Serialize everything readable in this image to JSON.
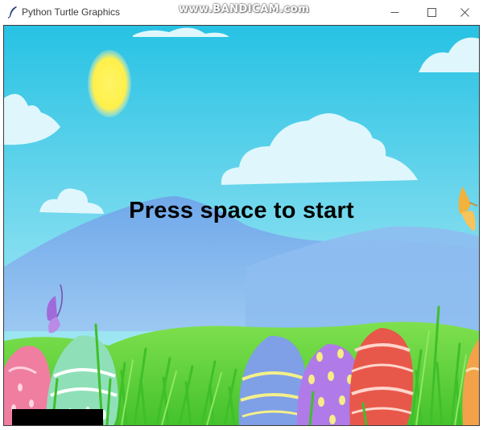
{
  "window": {
    "title": "Python Turtle Graphics",
    "watermark": "www.BANDICAM.com",
    "controls": [
      "minimize",
      "maximize",
      "close"
    ]
  },
  "game": {
    "message": "Press space to start",
    "background": {
      "sky_top": "#2fc6e6",
      "sky_bottom": "#a6ecf6",
      "sun": "#fff266",
      "mountain": "#7fb0ea",
      "hill": "#66d84a",
      "grass": "#3fbf2a"
    },
    "eggs": [
      {
        "name": "pink-egg",
        "color": "#f07ea0"
      },
      {
        "name": "mint-egg",
        "color": "#8fe0b8"
      },
      {
        "name": "blue-egg",
        "color": "#7f9fe6"
      },
      {
        "name": "purple-egg",
        "color": "#b07be8"
      },
      {
        "name": "red-egg",
        "color": "#e8584a"
      },
      {
        "name": "orange-egg",
        "color": "#f4a24a"
      }
    ],
    "butterflies": [
      {
        "name": "purple-butterfly-icon",
        "color": "#a06ad8"
      },
      {
        "name": "orange-butterfly-icon",
        "color": "#f2b23c"
      }
    ]
  }
}
